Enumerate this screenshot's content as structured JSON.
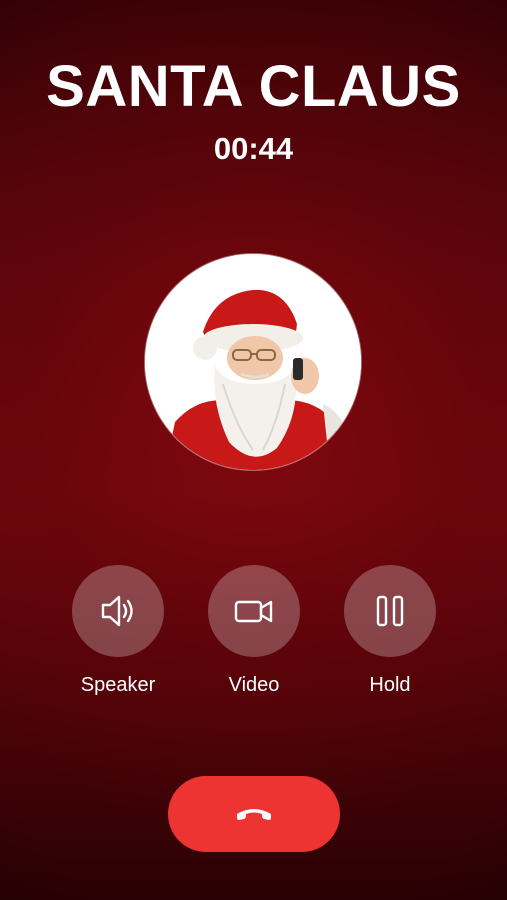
{
  "call": {
    "caller_name": "SANTA CLAUS",
    "timer": "00:44"
  },
  "controls": [
    {
      "label": "Speaker",
      "icon": "speaker-icon"
    },
    {
      "label": "Video",
      "icon": "video-camera-icon"
    },
    {
      "label": "Hold",
      "icon": "pause-icon"
    }
  ],
  "end_call": {
    "icon": "hang-up-phone-icon"
  },
  "colors": {
    "background": "#5a060c",
    "control_button": "rgba(255,255,255,0.26)",
    "end_call": "#ee3333",
    "text": "#ffffff"
  }
}
